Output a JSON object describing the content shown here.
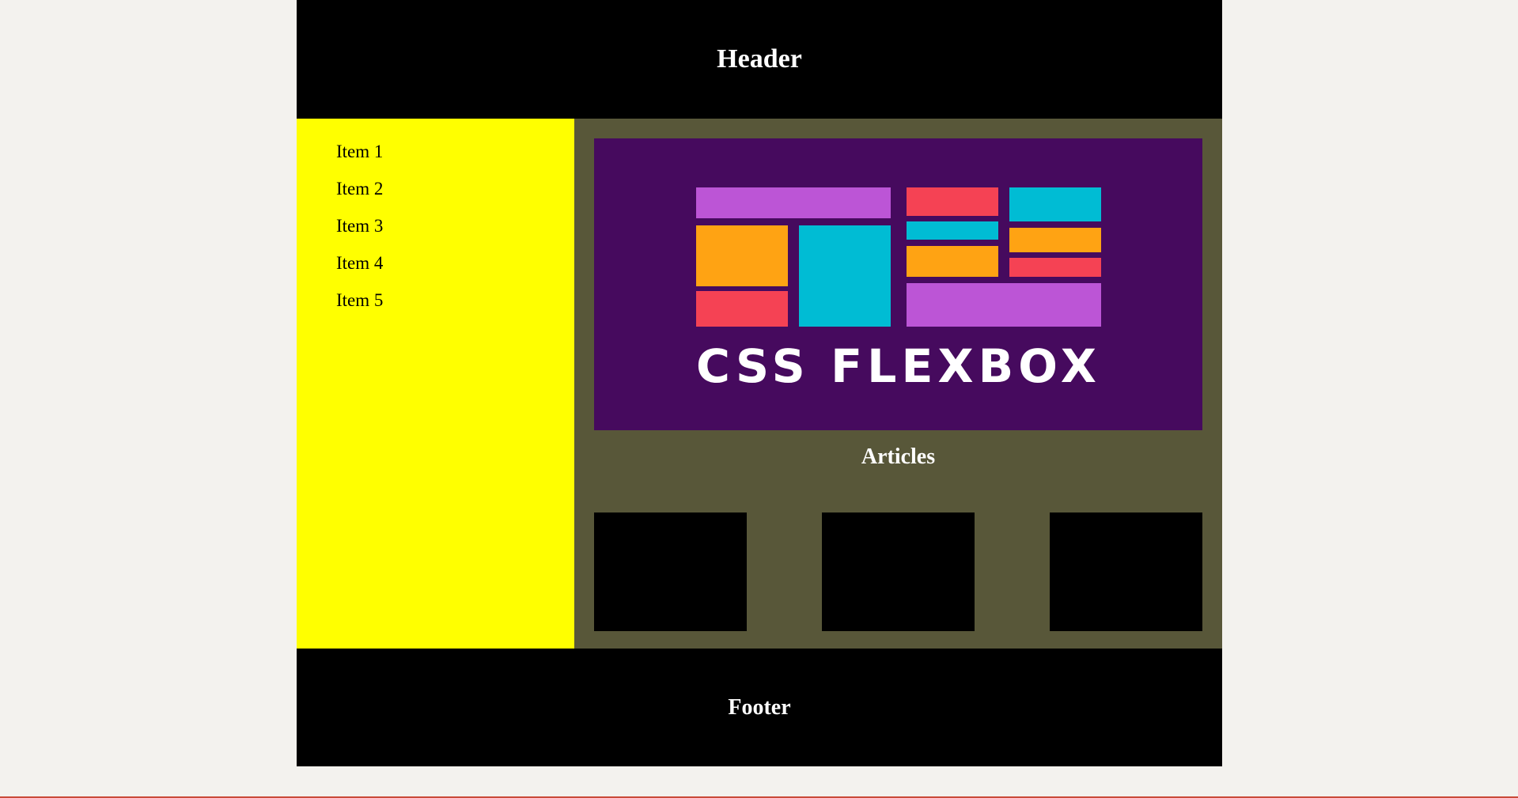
{
  "header": {
    "title": "Header"
  },
  "sidebar": {
    "items": [
      {
        "label": "Item 1"
      },
      {
        "label": "Item 2"
      },
      {
        "label": "Item 3"
      },
      {
        "label": "Item 4"
      },
      {
        "label": "Item 5"
      }
    ]
  },
  "main": {
    "hero": {
      "text": "CSS FLEXBOX",
      "icon": "css-flexbox-logo"
    },
    "articles_title": "Articles",
    "articles": [
      {},
      {},
      {}
    ]
  },
  "footer": {
    "title": "Footer"
  },
  "colors": {
    "header_bg": "#000000",
    "sidebar_bg": "#ffff00",
    "main_bg": "#585739",
    "hero_bg": "#460a5e",
    "footer_bg": "#000000",
    "page_bg": "#f3f2ee",
    "logo_purple": "#bc55d6",
    "logo_orange": "#ffa313",
    "logo_cyan": "#00bcd4",
    "logo_red": "#f54254"
  }
}
